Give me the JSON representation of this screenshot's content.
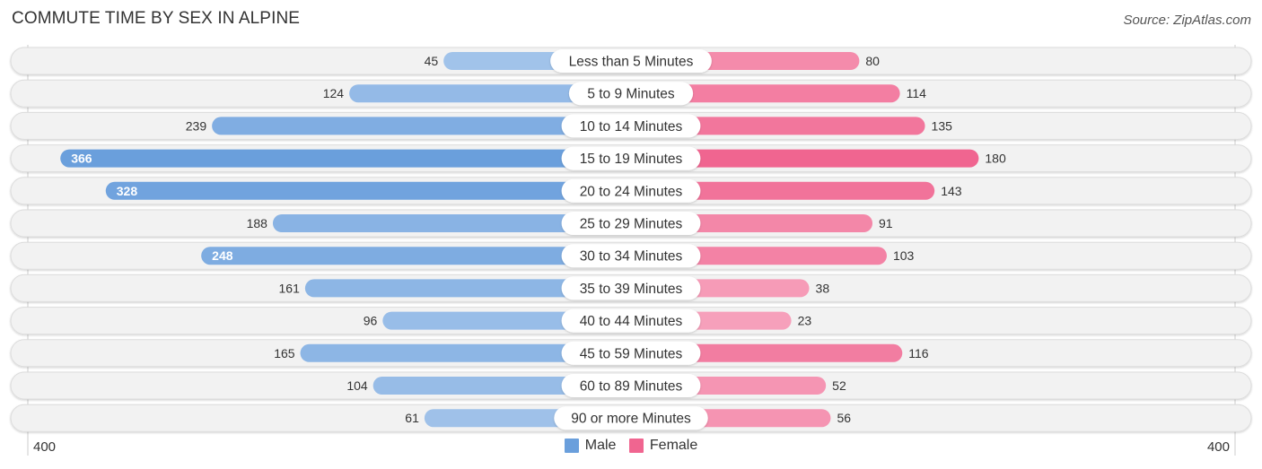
{
  "title": "COMMUTE TIME BY SEX IN ALPINE",
  "source": "Source: ZipAtlas.com",
  "colors": {
    "male": "#6a9fdc",
    "male_light": "#a9c8ec",
    "female": "#f06590",
    "female_light": "#f7a9c1",
    "track": "#f2f2f2",
    "track_border": "#dcdcdc"
  },
  "legend": [
    {
      "label": "Male",
      "color": "#6a9fdc"
    },
    {
      "label": "Female",
      "color": "#f06590"
    }
  ],
  "axis": {
    "left_label": "400",
    "right_label": "400"
  },
  "chart_data": {
    "type": "bar",
    "orientation": "horizontal-diverging",
    "title": "COMMUTE TIME BY SEX IN ALPINE",
    "categories": [
      "Less than 5 Minutes",
      "5 to 9 Minutes",
      "10 to 14 Minutes",
      "15 to 19 Minutes",
      "20 to 24 Minutes",
      "25 to 29 Minutes",
      "30 to 34 Minutes",
      "35 to 39 Minutes",
      "40 to 44 Minutes",
      "45 to 59 Minutes",
      "60 to 89 Minutes",
      "90 or more Minutes"
    ],
    "series": [
      {
        "name": "Male",
        "side": "left",
        "values": [
          45,
          124,
          239,
          366,
          328,
          188,
          248,
          161,
          96,
          165,
          104,
          61
        ]
      },
      {
        "name": "Female",
        "side": "right",
        "values": [
          80,
          114,
          135,
          180,
          143,
          91,
          103,
          38,
          23,
          116,
          52,
          56
        ]
      }
    ],
    "xlim": [
      0,
      400
    ],
    "xlabel": "",
    "ylabel": "",
    "legend_position": "bottom-center",
    "grid": false
  }
}
